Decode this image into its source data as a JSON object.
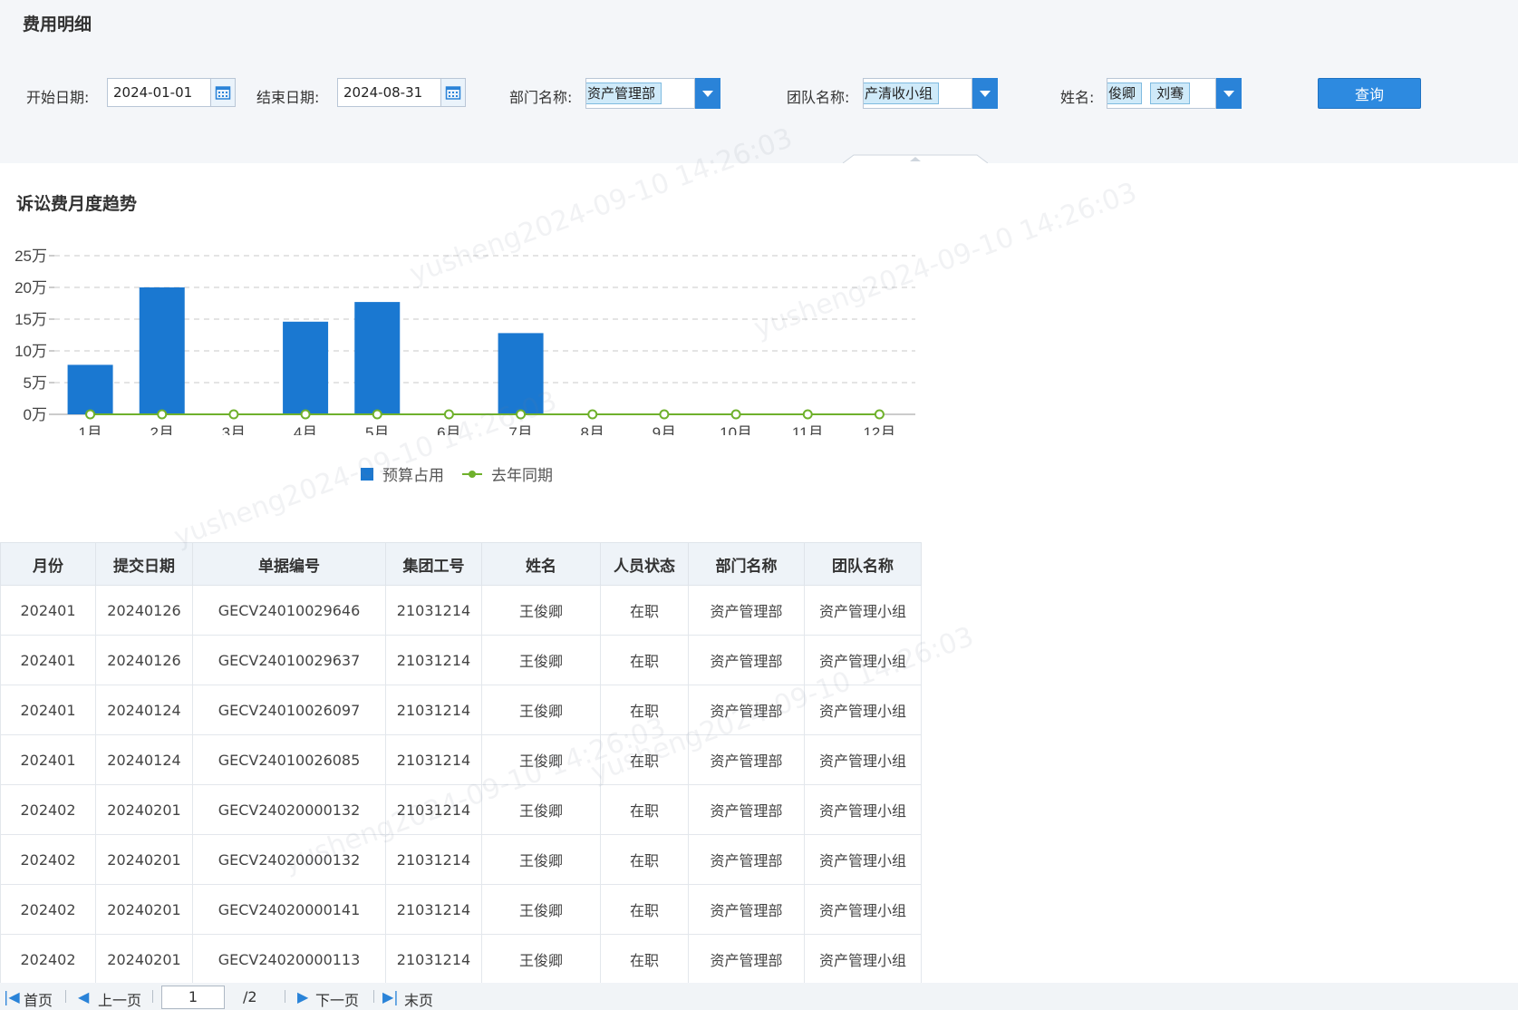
{
  "page": {
    "title": "费用明细"
  },
  "filters": {
    "start_label": "开始日期:",
    "start_value": "2024-01-01",
    "end_label": "结束日期:",
    "end_value": "2024-08-31",
    "dept_label": "部门名称:",
    "dept_tags": [
      "资产管理部"
    ],
    "team_label": "团队名称:",
    "team_tags": [
      "产清收小组"
    ],
    "name_label": "姓名:",
    "name_tags": [
      "俊卿",
      "刘骞"
    ],
    "query_label": "查询"
  },
  "chart_title": "诉讼费月度趋势",
  "chart_data": {
    "type": "bar",
    "categories": [
      "1月",
      "2月",
      "3月",
      "4月",
      "5月",
      "6月",
      "7月",
      "8月",
      "9月",
      "10月",
      "11月",
      "12月"
    ],
    "y_tick_labels": [
      "0万",
      "5万",
      "10万",
      "15万",
      "20万",
      "25万"
    ],
    "ylim": [
      0,
      25
    ],
    "grid": true,
    "legend_position": "bottom",
    "series": [
      {
        "name": "预算占用",
        "type": "bar",
        "color": "#1a78d1",
        "values": [
          7.8,
          20,
          0,
          14.6,
          17.7,
          0,
          12.8,
          0,
          0,
          0,
          0,
          0
        ]
      },
      {
        "name": "去年同期",
        "type": "line",
        "color": "#6fb12c",
        "values": [
          0,
          0,
          0,
          0,
          0,
          0,
          0,
          0,
          0,
          0,
          0,
          0
        ]
      }
    ]
  },
  "table": {
    "columns": [
      "月份",
      "提交日期",
      "单据编号",
      "集团工号",
      "姓名",
      "人员状态",
      "部门名称",
      "团队名称"
    ],
    "rows": [
      [
        "202401",
        "20240126",
        "GECV24010029646",
        "21031214",
        "王俊卿",
        "在职",
        "资产管理部",
        "资产管理小组"
      ],
      [
        "202401",
        "20240126",
        "GECV24010029637",
        "21031214",
        "王俊卿",
        "在职",
        "资产管理部",
        "资产管理小组"
      ],
      [
        "202401",
        "20240124",
        "GECV24010026097",
        "21031214",
        "王俊卿",
        "在职",
        "资产管理部",
        "资产管理小组"
      ],
      [
        "202401",
        "20240124",
        "GECV24010026085",
        "21031214",
        "王俊卿",
        "在职",
        "资产管理部",
        "资产管理小组"
      ],
      [
        "202402",
        "20240201",
        "GECV24020000132",
        "21031214",
        "王俊卿",
        "在职",
        "资产管理部",
        "资产管理小组"
      ],
      [
        "202402",
        "20240201",
        "GECV24020000132",
        "21031214",
        "王俊卿",
        "在职",
        "资产管理部",
        "资产管理小组"
      ],
      [
        "202402",
        "20240201",
        "GECV24020000141",
        "21031214",
        "王俊卿",
        "在职",
        "资产管理部",
        "资产管理小组"
      ],
      [
        "202402",
        "20240201",
        "GECV24020000113",
        "21031214",
        "王俊卿",
        "在职",
        "资产管理部",
        "资产管理小组"
      ]
    ]
  },
  "pager": {
    "first": "首页",
    "prev": "上一页",
    "current_page": "1",
    "total_pages": "/2",
    "next": "下一页",
    "last": "末页"
  },
  "watermark": "yusheng2024-09-10 14:26:03"
}
